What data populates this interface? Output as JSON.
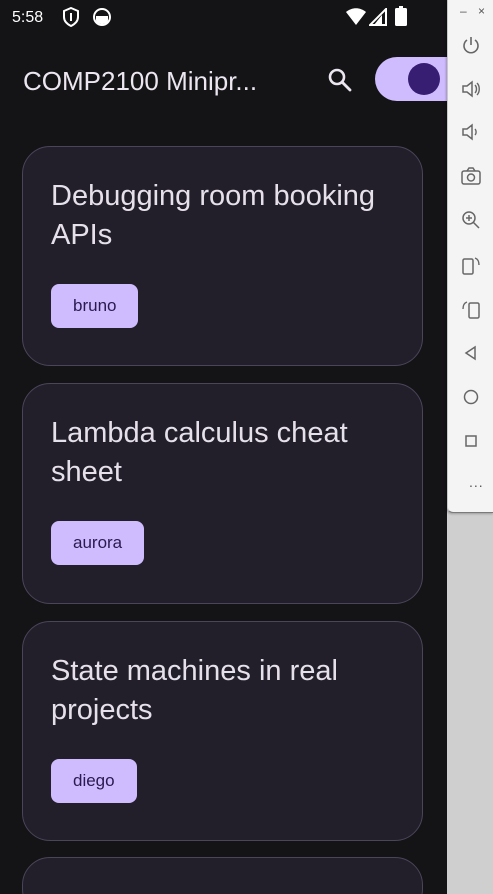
{
  "status": {
    "time": "5:58"
  },
  "appbar": {
    "title": "COMP2100 Minipr..."
  },
  "cards": [
    {
      "title": "Debugging room booking APIs",
      "author": "bruno"
    },
    {
      "title": "Lambda calculus cheat sheet",
      "author": "aurora"
    },
    {
      "title": "State machines in real projects",
      "author": "diego"
    }
  ],
  "emulator": {
    "minimize": "–",
    "close": "×",
    "more": "..."
  },
  "colors": {
    "accent": "#cfbcff",
    "surface": "#221f2b",
    "background": "#141316"
  }
}
